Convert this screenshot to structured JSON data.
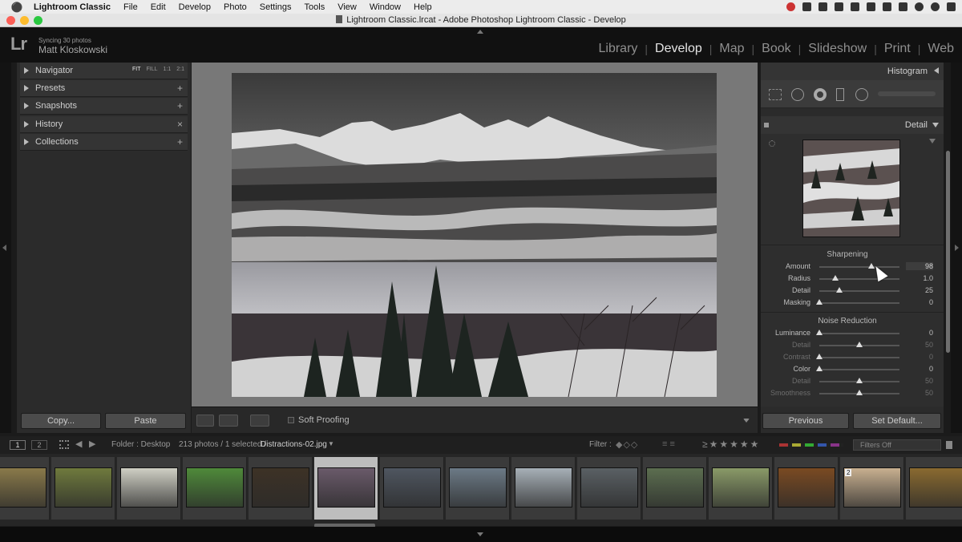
{
  "menubar": {
    "apple": "",
    "app_name": "Lightroom Classic",
    "items": [
      "File",
      "Edit",
      "Develop",
      "Photo",
      "Settings",
      "Tools",
      "View",
      "Window",
      "Help"
    ]
  },
  "window": {
    "title": "Lightroom Classic.lrcat - Adobe Photoshop Lightroom Classic - Develop"
  },
  "identity": {
    "logo": "Lr",
    "sync_status": "Syncing 30 photos",
    "user_name": "Matt Kloskowski"
  },
  "modules": {
    "items": [
      "Library",
      "Develop",
      "Map",
      "Book",
      "Slideshow",
      "Print",
      "Web"
    ],
    "active": "Develop"
  },
  "left_panel": {
    "navigator": {
      "label": "Navigator",
      "zoom_options": [
        "FIT",
        "FILL",
        "1:1",
        "2:1"
      ],
      "zoom_selected": "FIT"
    },
    "presets": {
      "label": "Presets",
      "action": "+"
    },
    "snapshots": {
      "label": "Snapshots",
      "action": "+"
    },
    "history": {
      "label": "History",
      "action": "×"
    },
    "collections": {
      "label": "Collections",
      "action": "+"
    },
    "copy_label": "Copy...",
    "paste_label": "Paste"
  },
  "toolbar": {
    "soft_proofing_label": "Soft Proofing",
    "soft_proofing_checked": false
  },
  "right_panel": {
    "histogram_label": "Histogram",
    "detail_label": "Detail",
    "sharpening": {
      "title": "Sharpening",
      "sliders": [
        {
          "label": "Amount",
          "value": "98",
          "fraction": 0.65
        },
        {
          "label": "Radius",
          "value": "1.0",
          "fraction": 0.2
        },
        {
          "label": "Detail",
          "value": "25",
          "fraction": 0.25
        },
        {
          "label": "Masking",
          "value": "0",
          "fraction": 0.0
        }
      ]
    },
    "noise_reduction": {
      "title": "Noise Reduction",
      "sliders": [
        {
          "label": "Luminance",
          "value": "0",
          "fraction": 0.0,
          "dim": false
        },
        {
          "label": "Detail",
          "value": "50",
          "fraction": 0.5,
          "dim": true
        },
        {
          "label": "Contrast",
          "value": "0",
          "fraction": 0.0,
          "dim": true
        },
        {
          "label": "Color",
          "value": "0",
          "fraction": 0.0,
          "dim": false
        },
        {
          "label": "Detail",
          "value": "50",
          "fraction": 0.5,
          "dim": true
        },
        {
          "label": "Smoothness",
          "value": "50",
          "fraction": 0.5,
          "dim": true
        }
      ]
    },
    "previous_label": "Previous",
    "set_default_label": "Set Default..."
  },
  "filmstrip_bar": {
    "page_1": "1",
    "page_2": "2",
    "folder": "Folder : Desktop",
    "count": "213 photos / 1 selected /",
    "selected_file": "Distractions-02.jpg",
    "filter_label": "Filter :",
    "filters_off": "Filters Off"
  },
  "filmstrip": {
    "count_badge": "2",
    "colors": [
      "#8a7a4a",
      "#6f7a3d",
      "#cfcfc4",
      "#4f8a3a",
      "#3d3226",
      "#6a5a6a",
      "#4f5660",
      "#6c7a86",
      "#a7b0b7",
      "#5a6064",
      "#5c6e50",
      "#8a9a68",
      "#7a4a22",
      "#c8b090",
      "#8a6a30"
    ],
    "selected_index": 5
  }
}
